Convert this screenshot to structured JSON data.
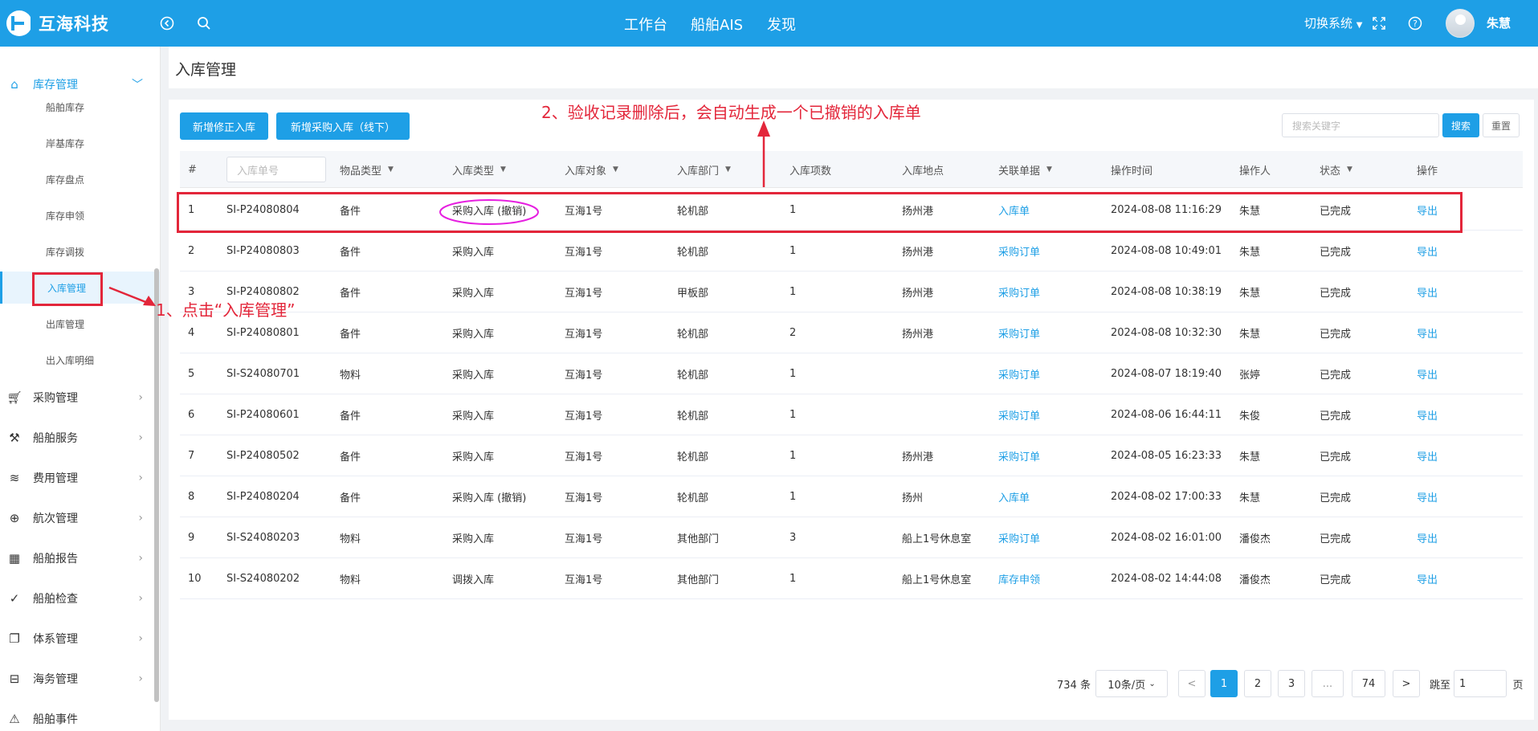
{
  "header": {
    "brand": "互海科技",
    "nav": [
      "工作台",
      "船舶AIS",
      "发现"
    ],
    "switch_system": "切换系统",
    "user_name": "朱慧",
    "icons": [
      "back-icon",
      "search-icon",
      "fullscreen-icon",
      "help-icon"
    ]
  },
  "sidebar": {
    "parents": [
      {
        "label": "库存管理",
        "icon": "home-icon",
        "expanded": true
      },
      {
        "label": "采购管理",
        "icon": "cart-icon"
      },
      {
        "label": "船舶服务",
        "icon": "tool-icon"
      },
      {
        "label": "费用管理",
        "icon": "database-icon"
      },
      {
        "label": "航次管理",
        "icon": "globe-icon"
      },
      {
        "label": "船舶报告",
        "icon": "calendar-icon"
      },
      {
        "label": "船舶检查",
        "icon": "check-icon"
      },
      {
        "label": "体系管理",
        "icon": "document-icon"
      },
      {
        "label": "海务管理",
        "icon": "signpost-icon"
      },
      {
        "label": "船舶事件",
        "icon": "warning-icon"
      }
    ],
    "children": [
      "船舶库存",
      "岸基库存",
      "库存盘点",
      "库存申领",
      "库存调拨",
      "入库管理",
      "出库管理",
      "出入库明细"
    ],
    "selected_child": "入库管理"
  },
  "page": {
    "title": "入库管理"
  },
  "toolbar": {
    "add_correction": "新增修正入库",
    "add_purchase": "新增采购入库（线下）",
    "search_placeholder": "搜索关键字",
    "search": "搜索",
    "reset": "重置"
  },
  "table": {
    "columns": [
      "#",
      "入库单号",
      "物品类型",
      "入库类型",
      "入库对象",
      "入库部门",
      "入库项数",
      "入库地点",
      "关联单据",
      "操作时间",
      "操作人",
      "状态",
      "操作"
    ],
    "rows": [
      [
        "1",
        "SI-P24080804",
        "备件",
        "采购入库 (撤销)",
        "互海1号",
        "轮机部",
        "1",
        "扬州港",
        "入库单",
        "2024-08-08 11:16:29",
        "朱慧",
        "已完成",
        "导出"
      ],
      [
        "2",
        "SI-P24080803",
        "备件",
        "采购入库",
        "互海1号",
        "轮机部",
        "1",
        "扬州港",
        "采购订单",
        "2024-08-08 10:49:01",
        "朱慧",
        "已完成",
        "导出"
      ],
      [
        "3",
        "SI-P24080802",
        "备件",
        "采购入库",
        "互海1号",
        "甲板部",
        "1",
        "扬州港",
        "采购订单",
        "2024-08-08 10:38:19",
        "朱慧",
        "已完成",
        "导出"
      ],
      [
        "4",
        "SI-P24080801",
        "备件",
        "采购入库",
        "互海1号",
        "轮机部",
        "2",
        "扬州港",
        "采购订单",
        "2024-08-08 10:32:30",
        "朱慧",
        "已完成",
        "导出"
      ],
      [
        "5",
        "SI-S24080701",
        "物料",
        "采购入库",
        "互海1号",
        "轮机部",
        "1",
        "",
        "采购订单",
        "2024-08-07 18:19:40",
        "张婷",
        "已完成",
        "导出"
      ],
      [
        "6",
        "SI-P24080601",
        "备件",
        "采购入库",
        "互海1号",
        "轮机部",
        "1",
        "",
        "采购订单",
        "2024-08-06 16:44:11",
        "朱俊",
        "已完成",
        "导出"
      ],
      [
        "7",
        "SI-P24080502",
        "备件",
        "采购入库",
        "互海1号",
        "轮机部",
        "1",
        "扬州港",
        "采购订单",
        "2024-08-05 16:23:33",
        "朱慧",
        "已完成",
        "导出"
      ],
      [
        "8",
        "SI-P24080204",
        "备件",
        "采购入库 (撤销)",
        "互海1号",
        "轮机部",
        "1",
        "扬州",
        "入库单",
        "2024-08-02 17:00:33",
        "朱慧",
        "已完成",
        "导出"
      ],
      [
        "9",
        "SI-S24080203",
        "物料",
        "采购入库",
        "互海1号",
        "其他部门",
        "3",
        "船上1号休息室",
        "采购订单",
        "2024-08-02 16:01:00",
        "潘俊杰",
        "已完成",
        "导出"
      ],
      [
        "10",
        "SI-S24080202",
        "物料",
        "调拨入库",
        "互海1号",
        "其他部门",
        "1",
        "船上1号休息室",
        "库存申领",
        "2024-08-02 14:44:08",
        "潘俊杰",
        "已完成",
        "导出"
      ]
    ]
  },
  "pagination": {
    "total": "734 条",
    "page_size": "10条/页",
    "pages": [
      "1",
      "2",
      "3",
      "...",
      "74"
    ],
    "current": "1",
    "prev": "<",
    "next": ">",
    "goto_label": "跳至",
    "goto_value": "1",
    "goto_suffix": "页"
  },
  "annotations": {
    "step1": "1、点击“入库管理”",
    "step2": "2、验收记录删除后，会自动生成一个已撤销的入库单"
  },
  "colors": {
    "primary": "#1e9fe6",
    "annotation_red": "#e3263a",
    "ellipse_magenta": "#e61fe0"
  }
}
